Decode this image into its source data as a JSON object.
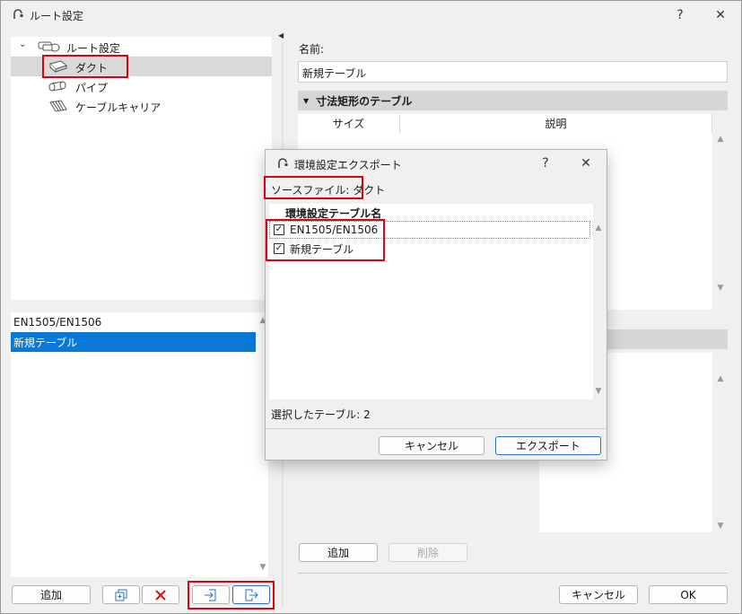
{
  "window": {
    "title": "ルート設定",
    "help": "?",
    "close": "✕"
  },
  "tree": {
    "root": "ルート設定",
    "items": [
      {
        "label": "ダクト"
      },
      {
        "label": "パイプ"
      },
      {
        "label": "ケーブルキャリア"
      }
    ]
  },
  "table_list": {
    "items": [
      "EN1505/EN1506",
      "新規テーブル"
    ]
  },
  "left_buttons": {
    "add": "追加"
  },
  "right": {
    "name_label": "名前:",
    "name_value": "新規テーブル",
    "section_title": "寸法矩形のテーブル",
    "col_size": "サイズ",
    "col_desc": "説明",
    "add": "追加",
    "delete": "削除",
    "cancel": "キャンセル",
    "ok": "OK"
  },
  "dialog": {
    "title": "環境設定エクスポート",
    "help": "?",
    "close": "✕",
    "source_label": "ソースファイル: ダクト",
    "col_header": "環境設定テーブル名",
    "rows": [
      {
        "label": "EN1505/EN1506",
        "checked": true
      },
      {
        "label": "新規テーブル",
        "checked": true
      }
    ],
    "selected_text": "選択したテーブル: 2",
    "cancel": "キャンセル",
    "export": "エクスポート"
  }
}
